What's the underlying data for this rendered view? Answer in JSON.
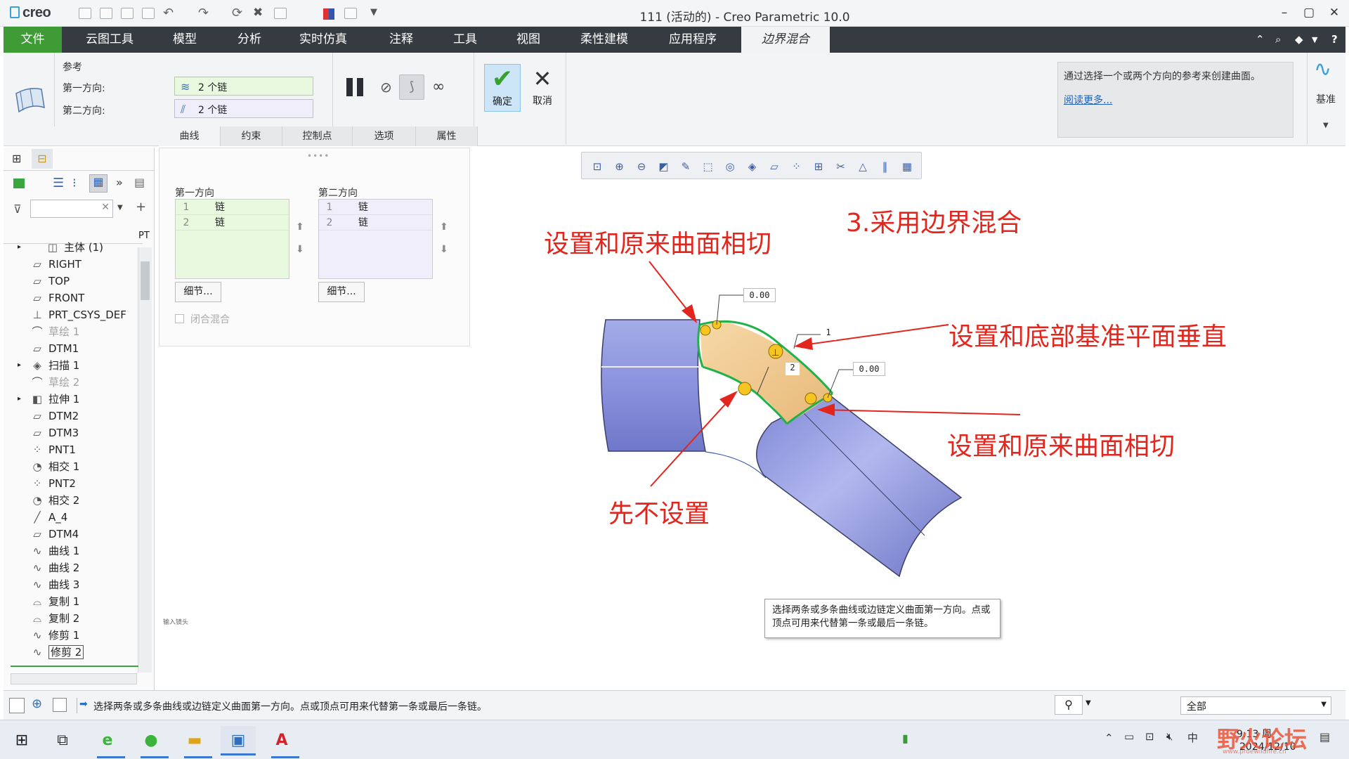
{
  "app": {
    "logo_text": "creo",
    "window_title": "111 (活动的) - Creo Parametric 10.0",
    "minimize": "–",
    "maximize": "▢",
    "close": "✕"
  },
  "ribbon_tabs": [
    "云图工具",
    "模型",
    "分析",
    "实时仿真",
    "注释",
    "工具",
    "视图",
    "柔性建模",
    "应用程序"
  ],
  "file_tab": "文件",
  "active_tab": "边界混合",
  "ribbon": {
    "references_label": "参考",
    "first_direction_label": "第一方向:",
    "first_direction_value": "2 个链",
    "second_direction_label": "第二方向:",
    "second_direction_value": "2 个链",
    "ok_label": "确定",
    "cancel_label": "取消",
    "datum_label": "基准",
    "info_text": "通过选择一个或两个方向的参考来创建曲面。",
    "info_link": "阅读更多..."
  },
  "subtabs": [
    "曲线",
    "约束",
    "控制点",
    "选项",
    "属性"
  ],
  "dashboard": {
    "first_dir_title": "第一方向",
    "second_dir_title": "第二方向",
    "first_list": [
      {
        "n": "1",
        "label": "链"
      },
      {
        "n": "2",
        "label": "链"
      }
    ],
    "second_list": [
      {
        "n": "1",
        "label": "链"
      },
      {
        "n": "2",
        "label": "链"
      }
    ],
    "details_button": "细节...",
    "closed_blend": "闭合混合",
    "input_hint": "输入镜头"
  },
  "tree": {
    "header_col": "PT",
    "items": [
      {
        "label": "主体 (1)",
        "icon": "body-icon",
        "state": "normal"
      },
      {
        "label": "RIGHT",
        "icon": "plane-icon",
        "state": "normal"
      },
      {
        "label": "TOP",
        "icon": "plane-icon",
        "state": "normal"
      },
      {
        "label": "FRONT",
        "icon": "plane-icon",
        "state": "normal"
      },
      {
        "label": "PRT_CSYS_DEF",
        "icon": "csys-icon",
        "state": "normal"
      },
      {
        "label": "草绘 1",
        "icon": "sketch-icon",
        "state": "dim"
      },
      {
        "label": "DTM1",
        "icon": "plane-icon",
        "state": "normal"
      },
      {
        "label": "扫描 1",
        "icon": "sweep-icon",
        "state": "normal"
      },
      {
        "label": "草绘 2",
        "icon": "sketch-icon",
        "state": "dim"
      },
      {
        "label": "拉伸 1",
        "icon": "extrude-icon",
        "state": "normal"
      },
      {
        "label": "DTM2",
        "icon": "plane-icon",
        "state": "normal"
      },
      {
        "label": "DTM3",
        "icon": "plane-icon",
        "state": "normal"
      },
      {
        "label": "PNT1",
        "icon": "point-icon",
        "state": "normal"
      },
      {
        "label": "相交 1",
        "icon": "intersect-icon",
        "state": "normal"
      },
      {
        "label": "PNT2",
        "icon": "point-icon",
        "state": "normal"
      },
      {
        "label": "相交 2",
        "icon": "intersect-icon",
        "state": "normal"
      },
      {
        "label": "A_4",
        "icon": "axis-icon",
        "state": "normal"
      },
      {
        "label": "DTM4",
        "icon": "plane-icon",
        "state": "normal"
      },
      {
        "label": "曲线 1",
        "icon": "curve-icon",
        "state": "normal"
      },
      {
        "label": "曲线 2",
        "icon": "curve-icon",
        "state": "normal"
      },
      {
        "label": "曲线 3",
        "icon": "curve-icon",
        "state": "normal"
      },
      {
        "label": "复制 1",
        "icon": "copy-icon",
        "state": "normal"
      },
      {
        "label": "复制 2",
        "icon": "copy-icon",
        "state": "normal"
      },
      {
        "label": "修剪 1",
        "icon": "trim-icon",
        "state": "normal"
      },
      {
        "label": "修剪 2",
        "icon": "trim-icon",
        "state": "selected"
      }
    ]
  },
  "annotations": {
    "title": "3.采用边界混合",
    "tangent_top": "设置和原来曲面相切",
    "perpendicular": "设置和底部基准平面垂直",
    "tangent_bottom": "设置和原来曲面相切",
    "not_set": "先不设置"
  },
  "dims": {
    "d1": "0.00",
    "d2": "1",
    "d3": "2",
    "d4": "0.00"
  },
  "tooltip": "选择两条或多条曲线或边链定义曲面第一方向。点或顶点可用来代替第一条或最后一条链。",
  "status": {
    "message": "选择两条或多条曲线或边链定义曲面第一方向。点或顶点可用来代替第一条或最后一条链。",
    "filter": "全部"
  },
  "taskbar": {
    "time": "9:13 周",
    "date": "2024/12/10",
    "watermark": "野火论坛",
    "watermark_sub": "www.proewildfire.cn"
  },
  "colors": {
    "accent": "#3e9b36",
    "ribbon_dark": "#363b41",
    "annotation": "#e3261d",
    "surface": "#8d95e6",
    "blend": "#f0c98a"
  }
}
